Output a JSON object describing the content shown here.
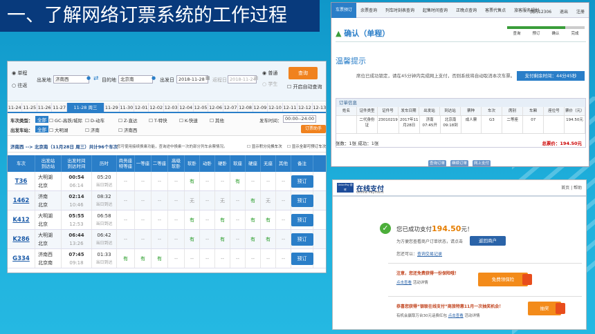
{
  "slide": {
    "title": "一、了解网络订票系统的工作过程"
  },
  "search": {
    "trip_oneway": "单程",
    "trip_round": "往返",
    "from_label": "出发地",
    "from_value": "济南西",
    "to_label": "目的地",
    "to_value": "北京南",
    "depart_label": "出发日",
    "depart_value": "2018-11-28",
    "return_label": "返程日",
    "return_value": "2018-11-24",
    "type_normal": "普通",
    "type_student": "学生",
    "query_btn": "查询",
    "auto_query": "开启自动查询"
  },
  "dates": [
    "11-24",
    "11-25",
    "11-26",
    "11-27",
    "11-28 周三",
    "11-29",
    "11-30",
    "12-01",
    "12-02",
    "12-03",
    "12-04",
    "12-05",
    "12-06",
    "12-07",
    "12-08",
    "12-09",
    "12-10",
    "12-11",
    "12-12",
    "12-13"
  ],
  "filters": {
    "type_label": "车次类型：",
    "all": "全部",
    "gc": "GC-高铁/城际",
    "d": "D-动车",
    "z": "Z-直达",
    "t": "T-特快",
    "k": "K-快速",
    "other": "其他",
    "station_label": "出发车站：",
    "s1": "大明湖",
    "s2": "济南",
    "s3": "济南西",
    "time_label": "发车时间：",
    "time_value": "00:00--24:00",
    "order_btn": "订票助手"
  },
  "info": {
    "route": "济南西 --> 北京南（11月28日 周三）共计96个车次",
    "tip": "您可使用接续换乘功能，查询途中换乘一次的部分列车余票情况。",
    "opt1": "显示积分兑换车次",
    "opt2": "显示全部可预订车次"
  },
  "table": {
    "headers": [
      "车次",
      "出发站\n到达站",
      "出发时间\n到达时间",
      "历时",
      "商务座\n特等座",
      "一等座",
      "二等座",
      "高级\n软卧",
      "软卧",
      "动卧",
      "硬卧",
      "软座",
      "硬座",
      "无座",
      "其他",
      "备注"
    ],
    "book_label": "预订",
    "rows": [
      {
        "train": "T36",
        "from": "大明湖",
        "to": "北京",
        "dep": "00:54",
        "arr": "06:14",
        "dur": "05:20",
        "day": "当日到达",
        "cells": [
          "--",
          "--",
          "--",
          "--",
          "有",
          "--",
          "--",
          "有",
          "--",
          "--",
          "--"
        ]
      },
      {
        "train": "1462",
        "from": "济南",
        "to": "北京",
        "dep": "02:14",
        "arr": "10:46",
        "dur": "08:32",
        "day": "当日到达",
        "cells": [
          "--",
          "--",
          "--",
          "--",
          "无",
          "--",
          "无",
          "--",
          "有",
          "无",
          "--"
        ]
      },
      {
        "train": "K412",
        "from": "大明湖",
        "to": "北京",
        "dep": "05:55",
        "arr": "12:53",
        "dur": "06:58",
        "day": "当日到达",
        "cells": [
          "--",
          "--",
          "--",
          "--",
          "有",
          "--",
          "有",
          "--",
          "有",
          "有",
          "--"
        ]
      },
      {
        "train": "K286",
        "from": "大明湖",
        "to": "北京",
        "dep": "06:44",
        "arr": "13:26",
        "dur": "06:42",
        "day": "当日到达",
        "cells": [
          "--",
          "--",
          "--",
          "--",
          "有",
          "--",
          "有",
          "--",
          "有",
          "有",
          "--"
        ]
      },
      {
        "train": "G334",
        "from": "济南西",
        "to": "北京南",
        "dep": "07:45",
        "arr": "09:18",
        "dur": "01:33",
        "day": "当日到达",
        "cells": [
          "有",
          "有",
          "有",
          "--",
          "--",
          "--",
          "--",
          "--",
          "--",
          "--",
          "--"
        ]
      }
    ]
  },
  "confirm": {
    "nav": [
      "车票预订",
      "余票查询",
      "列车时刻表查询",
      "起售时间查询",
      "正晚点查询",
      "客票代售点",
      "旅客服务规划"
    ],
    "user_links": [
      "我的12306",
      "退出",
      "注册"
    ],
    "title": "确认（单程）",
    "steps": [
      "查询",
      "预订",
      "确认",
      "完成"
    ],
    "warm_title": "温馨提示",
    "warm_text": "席位已成功锁定，请在45分钟内完成网上支付，否则系统将自动取消本次车票。",
    "timer": "支付剩余时间：44分45秒",
    "order_title": "订单信息",
    "order_headers": [
      "姓名",
      "证件类型",
      "证件号",
      "发车日期",
      "出发站",
      "到达站",
      "票种",
      "车次",
      "席别",
      "车厢",
      "座位号",
      "票价（元）"
    ],
    "order_row": [
      "",
      "二代身份证",
      "23010219",
      "2017年11月28日",
      "济南\n07:45开",
      "北京南\n09:18到",
      "成人票",
      "G3",
      "二等座",
      "07",
      "",
      "194.50元"
    ],
    "count_text": "张数：1张    成功：1张",
    "total_text": "总票价：194.50元",
    "buttons": [
      "查询订单",
      "继续订单",
      "网上支付"
    ]
  },
  "pay": {
    "brand": "在线支付",
    "brand_sub": "Online Payment",
    "logo": "UnionPay 银联",
    "links": "首页 | 帮助",
    "success": "您已成功支付",
    "amount": "194.50",
    "yuan": "元！",
    "line1": "为方便您查看商户订单状态，请点击",
    "return_btn": "返回商户",
    "line2a": "您还可以：",
    "line2b": "查询交易记录",
    "note1": "注意，您还免费获得一份保险哦！",
    "note1b_link": "点击查看",
    "note1b_rest": "活动详情",
    "gift1": "免费领保险",
    "note2": "恭喜您获得“银联在线支付”商旅特惠11月一次抽奖机会！",
    "note2b_a": "有机会赢取万台30元话费红包",
    "note2b_link": "点击查看",
    "note2b_rest": "活动详情",
    "gift2": "抽奖",
    "watermark": "Baidu经验"
  }
}
